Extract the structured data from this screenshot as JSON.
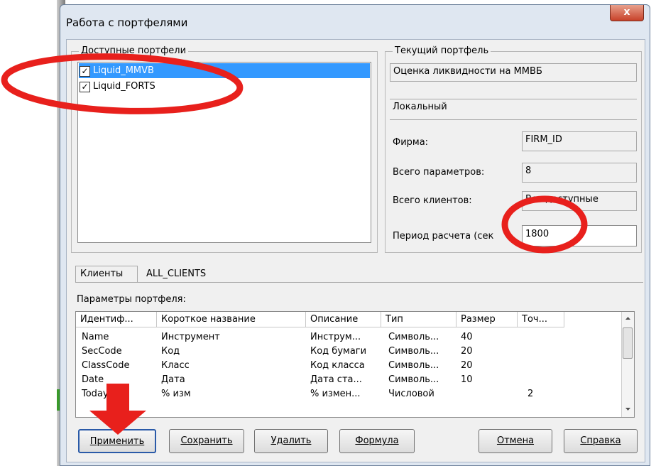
{
  "window": {
    "title": "Работа с портфелями",
    "close_glyph": "x"
  },
  "available": {
    "group_label": "Доступные портфели",
    "items": [
      {
        "label": "Liquid_MMVB",
        "checked": true,
        "selected": true
      },
      {
        "label": "Liquid_FORTS",
        "checked": true,
        "selected": false
      }
    ]
  },
  "current": {
    "group_label": "Текущий портфель",
    "name": "Оценка ликвидности на ММВБ",
    "type": "Локальный",
    "firm_label": "Фирма:",
    "firm_value": "FIRM_ID",
    "params_label": "Всего параметров:",
    "params_value": "8",
    "clients_label": "Всего клиентов:",
    "clients_value": "Все доступные",
    "period_label": "Период расчета (сек",
    "period_value": "1800"
  },
  "tabs": {
    "clients_tab": "Клиенты",
    "clients_value": "ALL_CLIENTS"
  },
  "params": {
    "section_label": "Параметры портфеля:",
    "columns": [
      "Идентиф...",
      "Короткое название",
      "Описание",
      "Тип",
      "Размер",
      "Точ..."
    ],
    "rows": [
      [
        "Name",
        "Инструмент",
        "Инструм...",
        "Символь...",
        "40",
        ""
      ],
      [
        "SecCode",
        "Код",
        "Код бумаги",
        "Символь...",
        "20",
        ""
      ],
      [
        "ClassCode",
        "Класс",
        "Код класса",
        "Символь...",
        "20",
        ""
      ],
      [
        "Date",
        "Дата",
        "Дата ста...",
        "Символь...",
        "10",
        ""
      ],
      [
        "Today...",
        "% изм",
        "% измен...",
        "Числовой",
        "",
        "2"
      ]
    ]
  },
  "buttons": {
    "apply": "Применить",
    "save": "Сохранить",
    "delete": "Удалить",
    "formula": "Формула",
    "cancel": "Отмена",
    "help": "Справка"
  },
  "colors": {
    "annotation_red": "#e8201c",
    "selection_blue": "#3399ff"
  }
}
